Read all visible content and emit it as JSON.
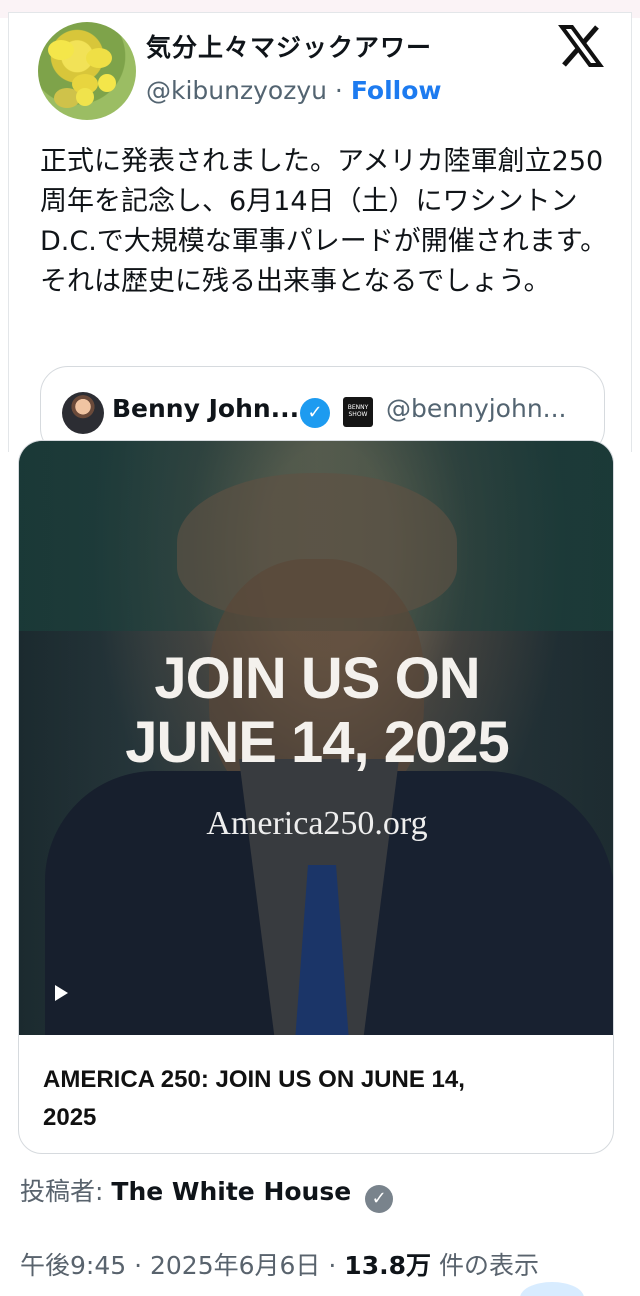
{
  "tweet": {
    "display_name": "気分上々マジックアワー",
    "handle": "@kibunzyozyu",
    "separator": "·",
    "follow_label": "Follow",
    "text": "正式に発表されました。アメリカ陸軍創立250周年を記念し、6月14日（土）にワシントンD.C.で大規模な軍事パレードが開催されます。それは歴史に残る出来事となるでしょう。"
  },
  "quote": {
    "name": "Benny John...",
    "handle": "@bennyjohn...",
    "badge_text": "BENNY SHOW"
  },
  "media": {
    "headline_line1": "JOIN US ON",
    "headline_line2": "JUNE 14, 2025",
    "url": "America250.org",
    "title_line1": "AMERICA 250: JOIN US ON JUNE 14,",
    "title_line2": "2025"
  },
  "footer": {
    "posted_by_label": "投稿者:",
    "posted_by_name": "The White House",
    "time": "午後9:45",
    "sep1": "·",
    "date": "2025年6月6日",
    "sep2": "·",
    "views": "13.8万",
    "views_label": "件の表示"
  },
  "icons": {
    "x_logo": "x-logo-icon",
    "verified": "verified-badge-icon",
    "play": "play-icon"
  },
  "colors": {
    "accent": "#1d7bf0",
    "muted": "#536471"
  }
}
